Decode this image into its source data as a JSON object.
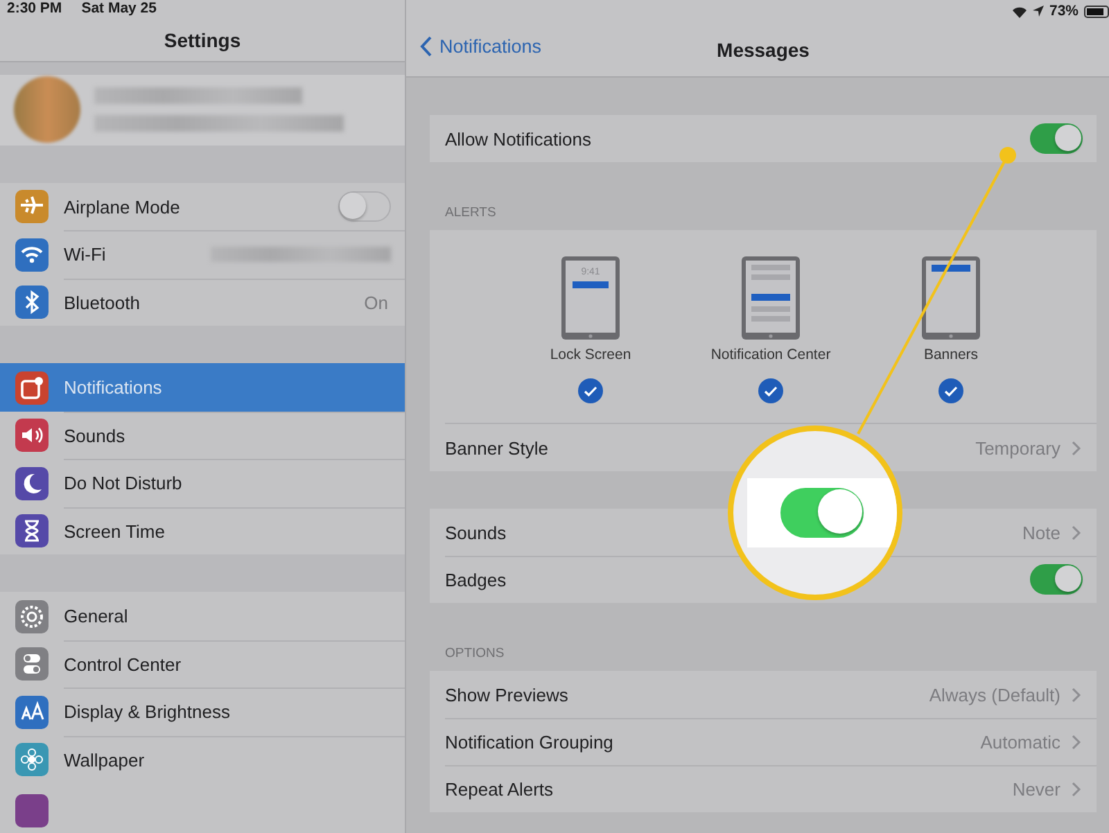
{
  "status_bar": {
    "time": "2:30 PM",
    "date": "Sat May 25",
    "battery": "73%"
  },
  "sidebar": {
    "title": "Settings",
    "groups": [
      {
        "items": [
          {
            "kind": "toggle",
            "label": "Airplane Mode",
            "on": false,
            "selected": false
          },
          {
            "kind": "blurred",
            "label": "Wi-Fi",
            "selected": false
          },
          {
            "kind": "value",
            "label": "Bluetooth",
            "value": "On",
            "selected": false
          }
        ]
      },
      {
        "items": [
          {
            "kind": "plain",
            "label": "Notifications",
            "selected": true
          },
          {
            "kind": "plain",
            "label": "Sounds",
            "selected": false
          },
          {
            "kind": "plain",
            "label": "Do Not Disturb",
            "selected": false
          },
          {
            "kind": "plain",
            "label": "Screen Time",
            "selected": false
          }
        ]
      },
      {
        "items": [
          {
            "kind": "plain",
            "label": "General",
            "selected": false
          },
          {
            "kind": "plain",
            "label": "Control Center",
            "selected": false
          },
          {
            "kind": "plain",
            "label": "Display & Brightness",
            "selected": false
          },
          {
            "kind": "plain",
            "label": "Wallpaper",
            "selected": false
          }
        ]
      }
    ]
  },
  "detail": {
    "back": "Notifications",
    "title": "Messages",
    "sections": [
      {
        "rows": [
          {
            "kind": "toggle",
            "label": "Allow Notifications",
            "on": true
          }
        ]
      },
      {
        "header": "ALERTS",
        "alert_styles": [
          {
            "label": "Lock Screen",
            "time": "9:41",
            "checked": true
          },
          {
            "label": "Notification Center",
            "checked": true
          },
          {
            "label": "Banners",
            "checked": true
          }
        ],
        "rows": [
          {
            "kind": "value",
            "label": "Banner Style",
            "value": "Temporary"
          }
        ]
      },
      {
        "rows": [
          {
            "kind": "value",
            "label": "Sounds",
            "value": "Note"
          },
          {
            "kind": "toggle",
            "label": "Badges",
            "on": true
          }
        ]
      },
      {
        "header": "OPTIONS",
        "rows": [
          {
            "kind": "value",
            "label": "Show Previews",
            "value": "Always (Default)"
          },
          {
            "kind": "value",
            "label": "Notification Grouping",
            "value": "Automatic"
          },
          {
            "kind": "value",
            "label": "Repeat Alerts",
            "value": "Never"
          }
        ]
      }
    ]
  },
  "callout": {
    "on": true
  }
}
